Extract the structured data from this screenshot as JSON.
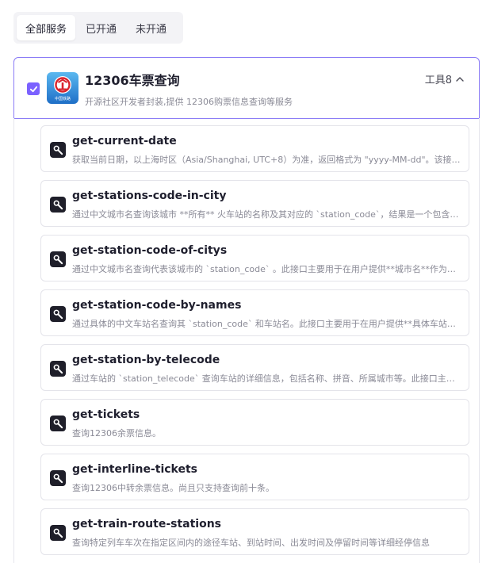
{
  "tabs": [
    {
      "label": "全部服务",
      "active": true
    },
    {
      "label": "已开通",
      "active": false
    },
    {
      "label": "未开通",
      "active": false
    }
  ],
  "provider": {
    "name": "12306车票查询",
    "description": "开源社区开发者封装,提供 12306购票信息查询等服务",
    "tool_count_label": "工具8",
    "checked": true,
    "logo_icon": "china-railway-logo",
    "logo_text": "中国铁路",
    "expand_icon": "chevron-up-icon",
    "accent_color": "#7b61ff"
  },
  "tools": [
    {
      "name": "get-current-date",
      "description": "获取当前日期，以上海时区（Asia/Shanghai, UTC+8）为准，返回格式为 \"yyyy-MM-dd\"。该接口可用于获取用户当前时间",
      "icon": "wrench-icon"
    },
    {
      "name": "get-stations-code-in-city",
      "description": "通过中文城市名查询该城市 **所有** 火车站的名称及其对应的 `station_code`，结果是一个包含多个车站信息的列表",
      "icon": "wrench-icon"
    },
    {
      "name": "get-station-code-of-citys",
      "description": "通过中文城市名查询代表该城市的 `station_code` 。此接口主要用于在用户提供**城市名**作为出发地或到达地时使用",
      "icon": "wrench-icon"
    },
    {
      "name": "get-station-code-by-names",
      "description": "通过具体的中文车站名查询其 `station_code` 和车站名。此接口主要用于在用户提供**具体车站名**作为出发地或到达地时使用",
      "icon": "wrench-icon"
    },
    {
      "name": "get-station-by-telecode",
      "description": "通过车站的 `station_telecode` 查询车站的详细信息，包括名称、拼音、所属城市等。此接口主要用于在已知车站代码时使用",
      "icon": "wrench-icon"
    },
    {
      "name": "get-tickets",
      "description": "查询12306余票信息。",
      "icon": "wrench-icon"
    },
    {
      "name": "get-interline-tickets",
      "description": "查询12306中转余票信息。尚且只支持查询前十条。",
      "icon": "wrench-icon"
    },
    {
      "name": "get-train-route-stations",
      "description": "查询特定列车车次在指定区间内的途径车站、到站时间、出发时间及停留时间等详细经停信息",
      "icon": "wrench-icon"
    }
  ]
}
